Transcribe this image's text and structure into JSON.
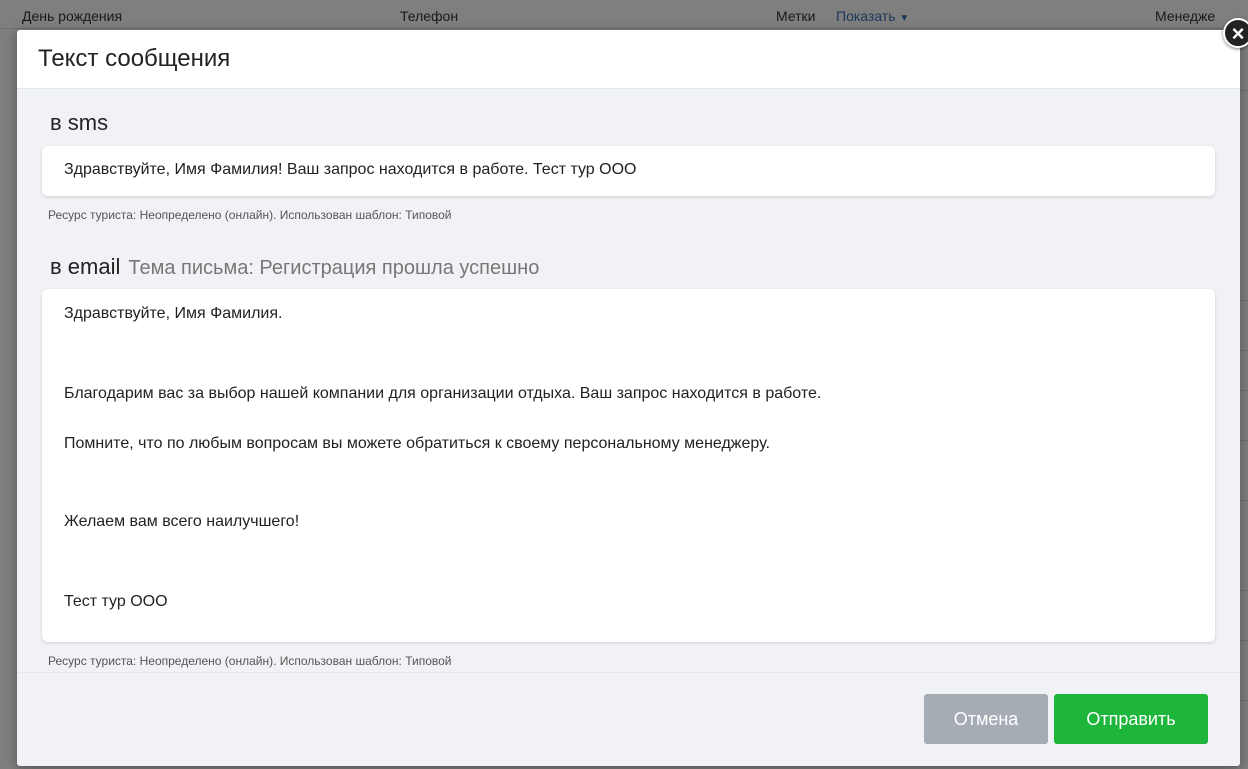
{
  "background": {
    "col_birthday": "День рождения",
    "col_phone": "Телефон",
    "col_tags": "Метки",
    "tags_show": "Показать",
    "col_manager": "Менедже"
  },
  "modal": {
    "title": "Текст сообщения",
    "close_symbol": "×",
    "sms": {
      "label": "в sms",
      "text": "Здравствуйте, Имя Фамилия! Ваш запрос находится в работе. Тест тур ООО",
      "meta": "Ресурс туриста: Неопределено (онлайн). Использован шаблон: Типовой"
    },
    "email": {
      "label": "в email",
      "subject": "Тема письма: Регистрация прошла успешно",
      "lines": [
        "Здравствуйте, Имя Фамилия.",
        "Благодарим вас за выбор нашей компании для организации отдыха. Ваш запрос находится в работе.",
        "Помните, что по любым вопросам вы можете обратиться к своему персональному менеджеру.",
        "Желаем вам всего наилучшего!",
        "Тест тур ООО"
      ],
      "meta": "Ресурс туриста: Неопределено (онлайн). Использован шаблон: Типовой"
    },
    "buttons": {
      "cancel": "Отмена",
      "send": "Отправить"
    }
  },
  "colors": {
    "send": "#1db63a",
    "cancel": "#a5acb3",
    "link": "#3b6fb6"
  },
  "icons": {
    "close": "close-icon",
    "dropdown": "caret-down-icon"
  }
}
